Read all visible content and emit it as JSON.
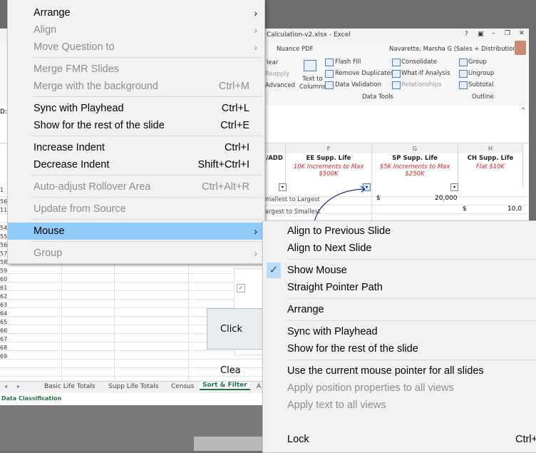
{
  "excel": {
    "title": "Calculation-v2.xlsx - Excel",
    "user": "Navarette, Marsha G (Sales + Distribution)",
    "ribbon_tab": "Nuance PDF",
    "ribbon": {
      "clear": "lear",
      "reapply": "Reapply",
      "advanced": "Advanced",
      "text_to_columns": "Text to\nColumns",
      "flash_fill": "Flash Fill",
      "remove_duplicates": "Remove Duplicates",
      "data_validation": "Data Validation",
      "consolidate": "Consolidate",
      "what_if": "What-If Analysis",
      "relationships": "Relationships",
      "group": "Group",
      "ungroup": "Ungroup",
      "subtotal": "Subtotal",
      "data_tools": "Data Tools",
      "outline": "Outline"
    },
    "columns": [
      "F",
      "G",
      "H"
    ],
    "cell_d1_partial": "D:",
    "add_header": "/ADD",
    "ee": {
      "title": "EE Supp. Life",
      "line1": "10K Increments to Max",
      "line2": "$500K"
    },
    "sp": {
      "title": "SP Supp. Life",
      "line1": "$5K Increments to Max",
      "line2": "$250K"
    },
    "ch": {
      "title": "CH Supp. Life",
      "line1": "Flat $10K"
    },
    "sort_smallest": "mallest to Largest",
    "sort_largest": "argest to Smallest",
    "value_g": "20,000",
    "value_h": "10,0",
    "dollar": "$",
    "click_clear": "Click Clea",
    "row_numbers": [
      "1",
      "56",
      "11",
      "54",
      "55",
      "56",
      "57",
      "58",
      "59",
      "60",
      "61",
      "62",
      "63",
      "64",
      "65",
      "66",
      "67",
      "68",
      "69"
    ],
    "sheet_tabs": [
      "Basic Life Totals",
      "Supp Life Totals",
      "Census",
      "Sort & Filter",
      "A"
    ],
    "active_tab": "Sort & Filter",
    "status": "Data Classification"
  },
  "context_menu": {
    "items": [
      {
        "label": "Arrange",
        "shortcut": "",
        "submenu": true,
        "disabled": false
      },
      {
        "label": "Align",
        "shortcut": "",
        "submenu": true,
        "disabled": true
      },
      {
        "label": "Move Question to",
        "shortcut": "",
        "submenu": true,
        "disabled": true
      },
      {
        "label": "Merge FMR Slides",
        "shortcut": "",
        "submenu": false,
        "disabled": true
      },
      {
        "label": "Merge with the background",
        "shortcut": "Ctrl+M",
        "submenu": false,
        "disabled": true
      },
      {
        "label": "Sync with Playhead",
        "shortcut": "Ctrl+L",
        "submenu": false,
        "disabled": false
      },
      {
        "label": "Show for the rest of the slide",
        "shortcut": "Ctrl+E",
        "submenu": false,
        "disabled": false
      },
      {
        "label": "Increase Indent",
        "shortcut": "Ctrl+I",
        "submenu": false,
        "disabled": false
      },
      {
        "label": "Decrease Indent",
        "shortcut": "Shift+Ctrl+I",
        "submenu": false,
        "disabled": false
      },
      {
        "label": "Auto-adjust Rollover Area",
        "shortcut": "Ctrl+Alt+R",
        "submenu": false,
        "disabled": true
      },
      {
        "label": "Update from Source",
        "shortcut": "",
        "submenu": false,
        "disabled": true
      },
      {
        "label": "Mouse",
        "shortcut": "",
        "submenu": true,
        "disabled": false,
        "highlighted": true
      },
      {
        "label": "Group",
        "shortcut": "",
        "submenu": true,
        "disabled": true
      }
    ]
  },
  "mouse_submenu": {
    "items": [
      {
        "label": "Align to Previous Slide",
        "shortcut": "",
        "disabled": false
      },
      {
        "label": "Align to Next Slide",
        "shortcut": "",
        "disabled": false
      },
      {
        "label": "Show Mouse",
        "shortcut": "",
        "disabled": false,
        "checked": true
      },
      {
        "label": "Straight Pointer Path",
        "shortcut": "",
        "disabled": false
      },
      {
        "label": "Arrange",
        "shortcut": "",
        "disabled": false
      },
      {
        "label": "Sync with Playhead",
        "shortcut": "",
        "disabled": false
      },
      {
        "label": "Show for the rest of the slide",
        "shortcut": "",
        "disabled": false
      },
      {
        "label": "Use the current mouse pointer for all slides",
        "shortcut": "",
        "disabled": false
      },
      {
        "label": "Apply position properties to all views",
        "shortcut": "",
        "disabled": true
      },
      {
        "label": "Apply text to all views",
        "shortcut": "",
        "disabled": true
      },
      {
        "label": "Lock",
        "shortcut": "Ctrl+",
        "disabled": false
      }
    ]
  },
  "colors": {
    "menu_bg": "#f2f2f2",
    "highlight": "#91c9f7",
    "disabled_text": "#8d8d8d",
    "excel_green": "#217346",
    "header_red": "#e02020"
  }
}
